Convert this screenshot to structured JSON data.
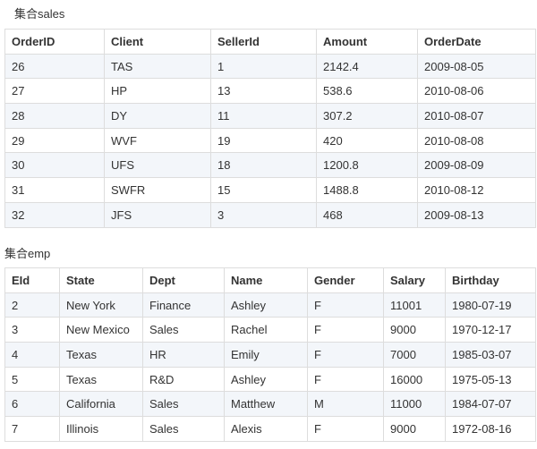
{
  "sales": {
    "caption": "集合sales",
    "columns": [
      "OrderID",
      "Client",
      "SellerId",
      "Amount",
      "OrderDate"
    ],
    "rows": [
      [
        "26",
        "TAS",
        "1",
        "2142.4",
        "2009-08-05"
      ],
      [
        "27",
        "HP",
        "13",
        "538.6",
        "2010-08-06"
      ],
      [
        "28",
        "DY",
        "11",
        "307.2",
        "2010-08-07"
      ],
      [
        "29",
        "WVF",
        "19",
        "420",
        "2010-08-08"
      ],
      [
        "30",
        "UFS",
        "18",
        "1200.8",
        "2009-08-09"
      ],
      [
        "31",
        "SWFR",
        "15",
        "1488.8",
        "2010-08-12"
      ],
      [
        "32",
        "JFS",
        "3",
        "468",
        "2009-08-13"
      ]
    ]
  },
  "emp": {
    "caption": "集合emp",
    "columns": [
      "EId",
      "State",
      "Dept",
      "Name",
      "Gender",
      "Salary",
      "Birthday"
    ],
    "rows": [
      [
        "2",
        "New York",
        "Finance",
        "Ashley",
        "F",
        "11001",
        "1980-07-19"
      ],
      [
        "3",
        "New Mexico",
        "Sales",
        "Rachel",
        "F",
        "9000",
        "1970-12-17"
      ],
      [
        "4",
        "Texas",
        "HR",
        "Emily",
        "F",
        "7000",
        "1985-03-07"
      ],
      [
        "5",
        "Texas",
        "R&D",
        "Ashley",
        "F",
        "16000",
        "1975-05-13"
      ],
      [
        "6",
        "California",
        "Sales",
        "Matthew",
        "M",
        "11000",
        "1984-07-07"
      ],
      [
        "7",
        "Illinois",
        "Sales",
        "Alexis",
        "F",
        "9000",
        "1972-08-16"
      ]
    ]
  }
}
